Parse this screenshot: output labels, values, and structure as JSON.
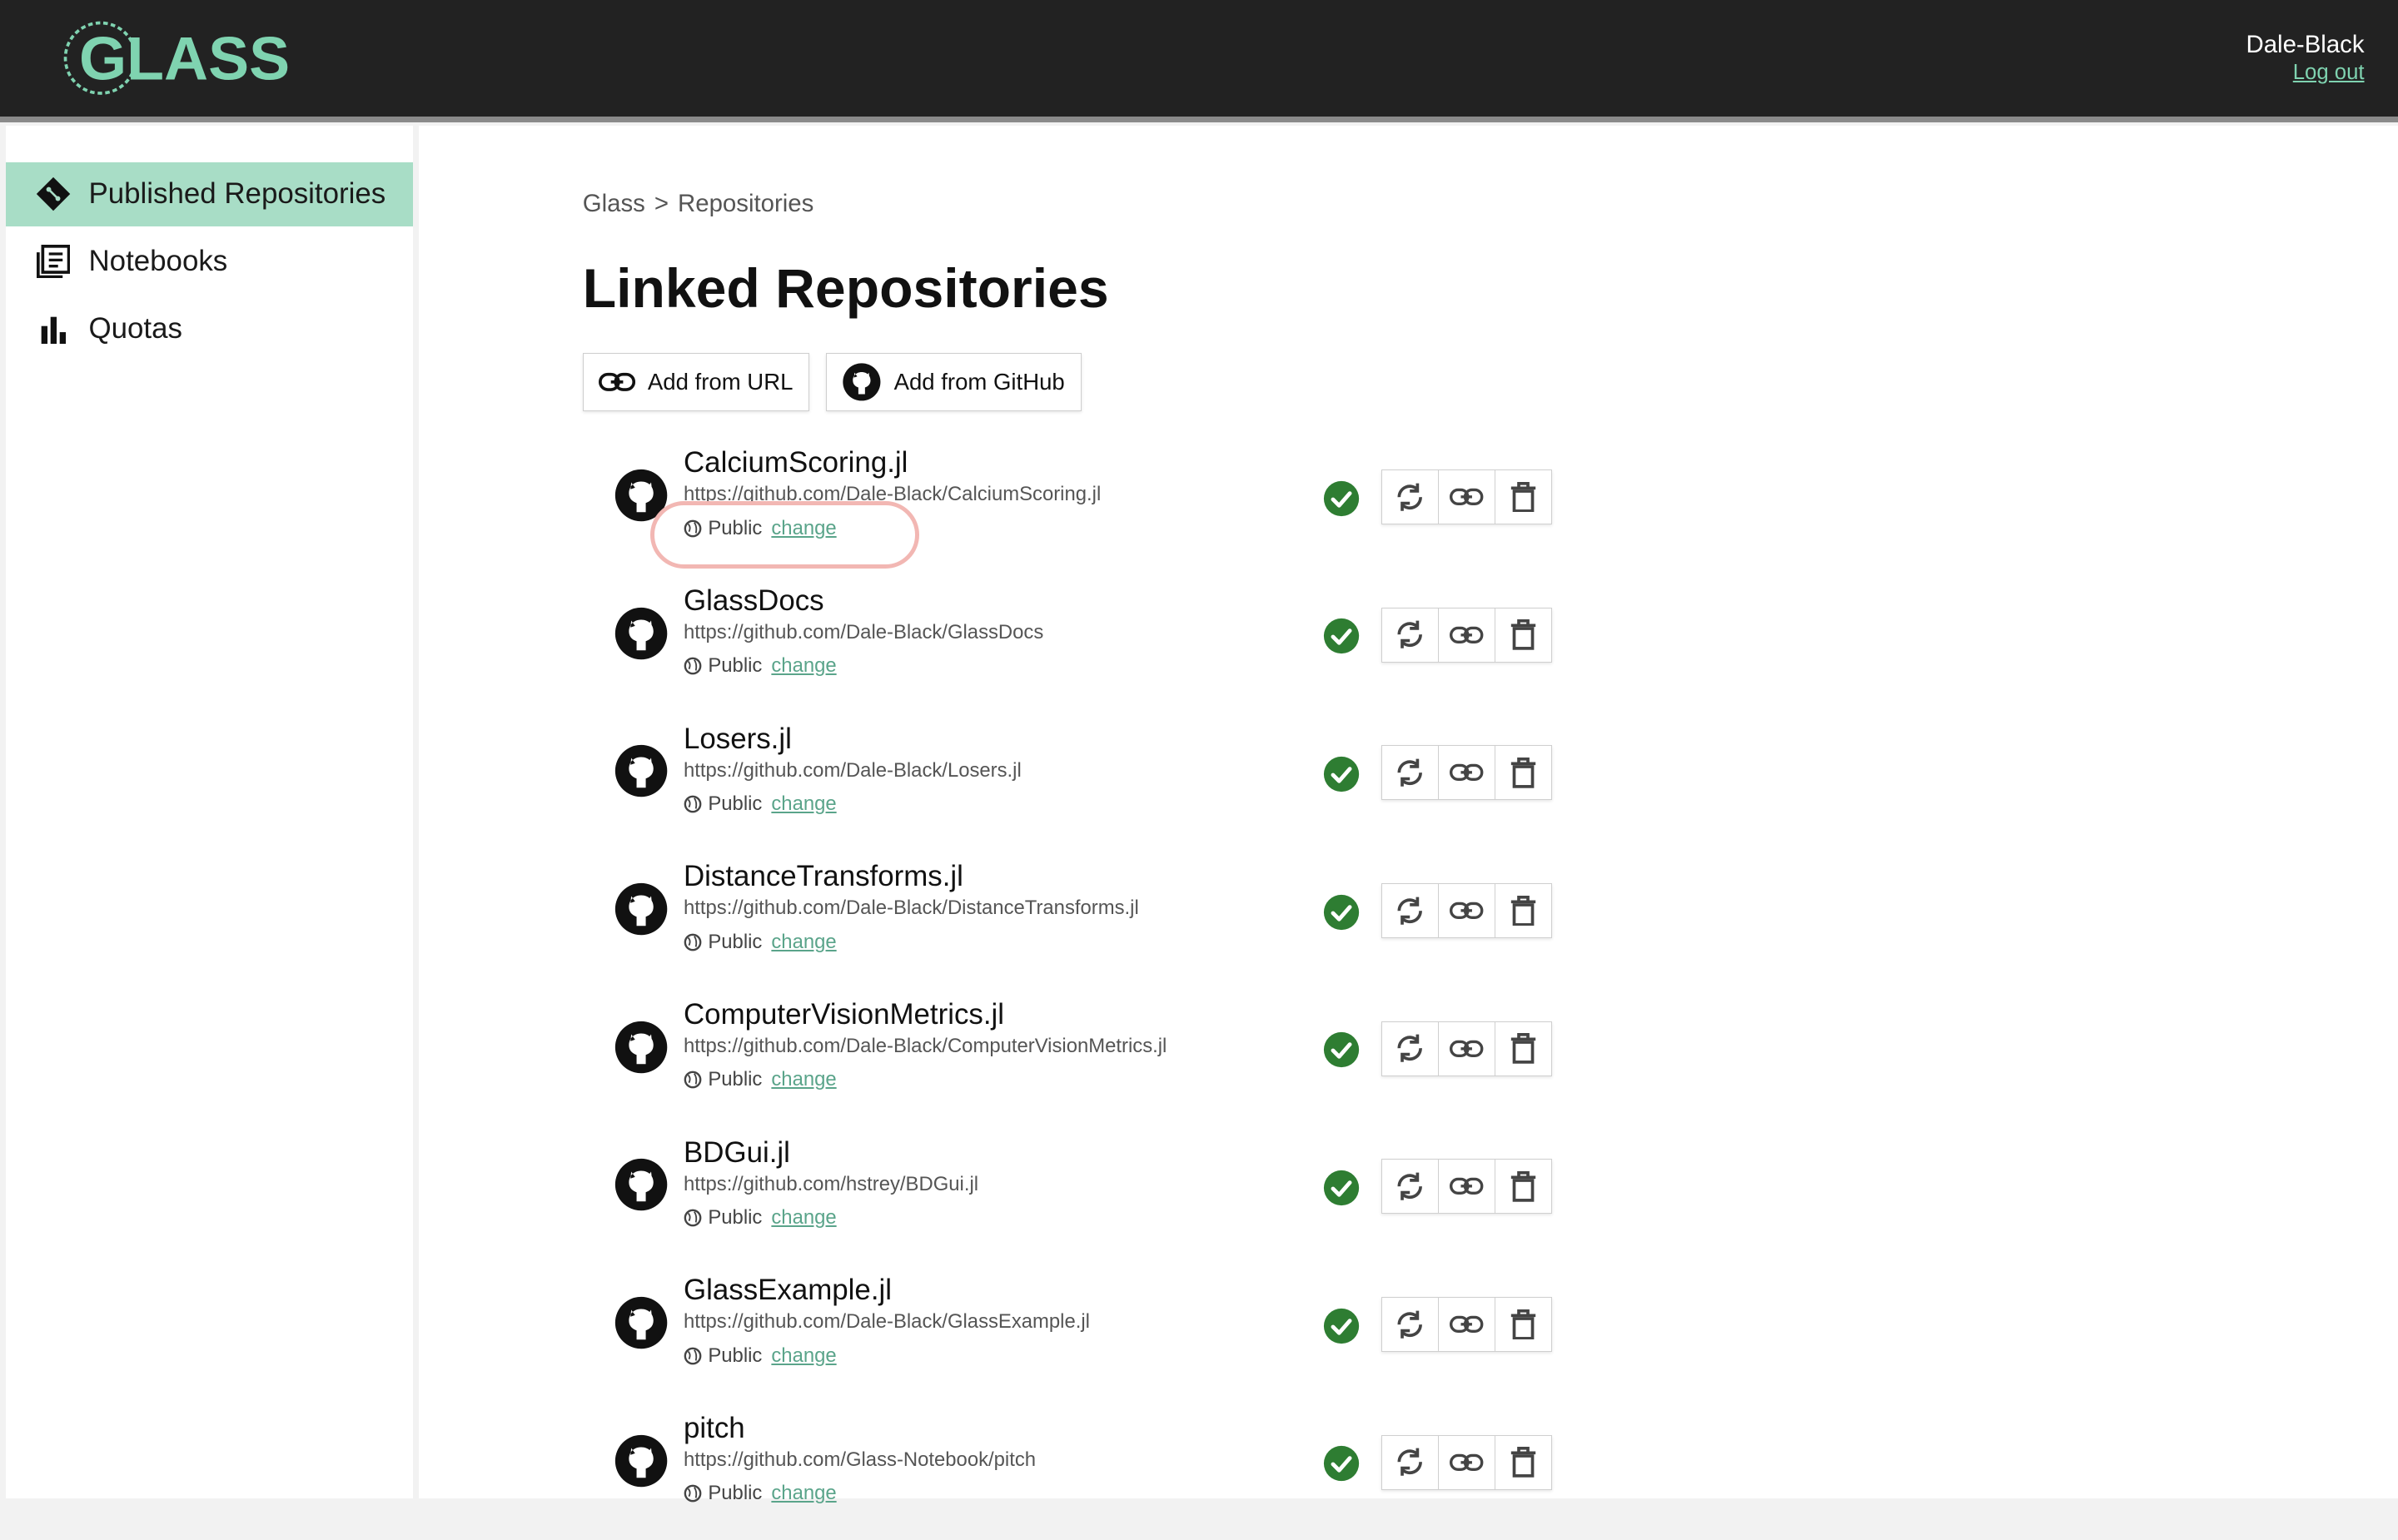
{
  "header": {
    "logo_text": "GLASS",
    "user_name": "Dale-Black",
    "logout_label": "Log out"
  },
  "sidebar": {
    "items": [
      {
        "label": "Published Repositories",
        "icon": "git-diamond-icon",
        "active": true
      },
      {
        "label": "Notebooks",
        "icon": "notebook-icon",
        "active": false
      },
      {
        "label": "Quotas",
        "icon": "bar-chart-icon",
        "active": false
      }
    ]
  },
  "breadcrumb": {
    "root": "Glass",
    "separator": ">",
    "current": "Repositories"
  },
  "page_title": "Linked Repositories",
  "buttons": {
    "add_url": "Add from URL",
    "add_github": "Add from GitHub"
  },
  "repos": [
    {
      "name": "CalciumScoring.jl",
      "url": "https://github.com/Dale-Black/CalciumScoring.jl",
      "visibility": "Public",
      "change": "change"
    },
    {
      "name": "GlassDocs",
      "url": "https://github.com/Dale-Black/GlassDocs",
      "visibility": "Public",
      "change": "change"
    },
    {
      "name": "Losers.jl",
      "url": "https://github.com/Dale-Black/Losers.jl",
      "visibility": "Public",
      "change": "change"
    },
    {
      "name": "DistanceTransforms.jl",
      "url": "https://github.com/Dale-Black/DistanceTransforms.jl",
      "visibility": "Public",
      "change": "change"
    },
    {
      "name": "ComputerVisionMetrics.jl",
      "url": "https://github.com/Dale-Black/ComputerVisionMetrics.jl",
      "visibility": "Public",
      "change": "change"
    },
    {
      "name": "BDGui.jl",
      "url": "https://github.com/hstrey/BDGui.jl",
      "visibility": "Public",
      "change": "change"
    },
    {
      "name": "GlassExample.jl",
      "url": "https://github.com/Dale-Black/GlassExample.jl",
      "visibility": "Public",
      "change": "change"
    },
    {
      "name": "pitch",
      "url": "https://github.com/Glass-Notebook/pitch",
      "visibility": "Public",
      "change": "change"
    }
  ],
  "colors": {
    "accent": "#7fd3b0",
    "active_bg": "#a8ddc6",
    "check_green": "#2e7d32",
    "topbar": "#222222",
    "highlight": "#f2b7b3"
  }
}
